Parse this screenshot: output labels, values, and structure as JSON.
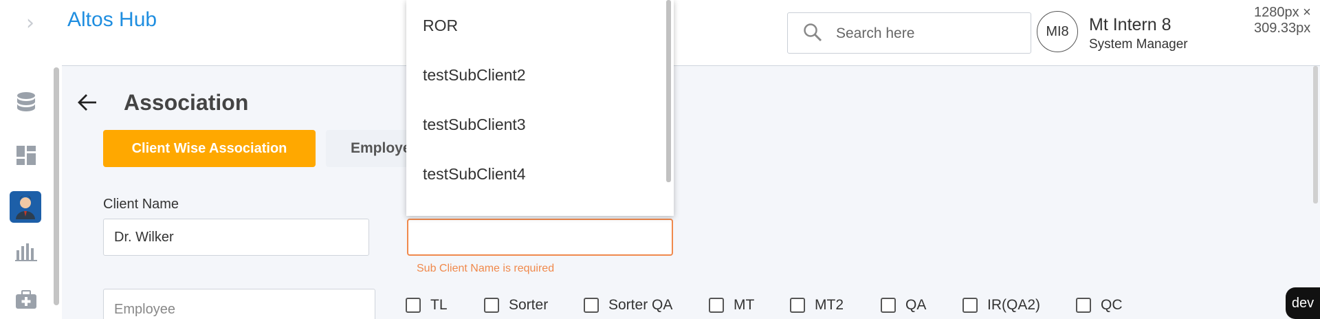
{
  "app": {
    "brand": "Altos Hub"
  },
  "header": {
    "search": {
      "placeholder": "Search here",
      "value": ""
    },
    "user": {
      "initials": "MI8",
      "name": "Mt Intern 8",
      "role": "System Manager"
    },
    "dimensions": "1280px × 309.33px"
  },
  "page": {
    "title": "Association",
    "tabs": [
      {
        "label": "Client Wise Association",
        "active": true
      },
      {
        "label": "Employe",
        "active": false
      }
    ]
  },
  "form": {
    "client_name_label": "Client Name",
    "client_name_value": "Dr. Wilker",
    "sub_client_value": "",
    "sub_client_error": "Sub Client Name is required",
    "employee_placeholder": "Employee"
  },
  "dropdown": {
    "options": [
      "ROR",
      "testSubClient2",
      "testSubClient3",
      "testSubClient4"
    ]
  },
  "roles": [
    "TL",
    "Sorter",
    "Sorter QA",
    "MT",
    "MT2",
    "QA",
    "IR(QA2)",
    "QC"
  ],
  "env_badge": "dev",
  "colors": {
    "accent": "#ffa800",
    "brand": "#1f8ee0",
    "error": "#f0894c"
  }
}
